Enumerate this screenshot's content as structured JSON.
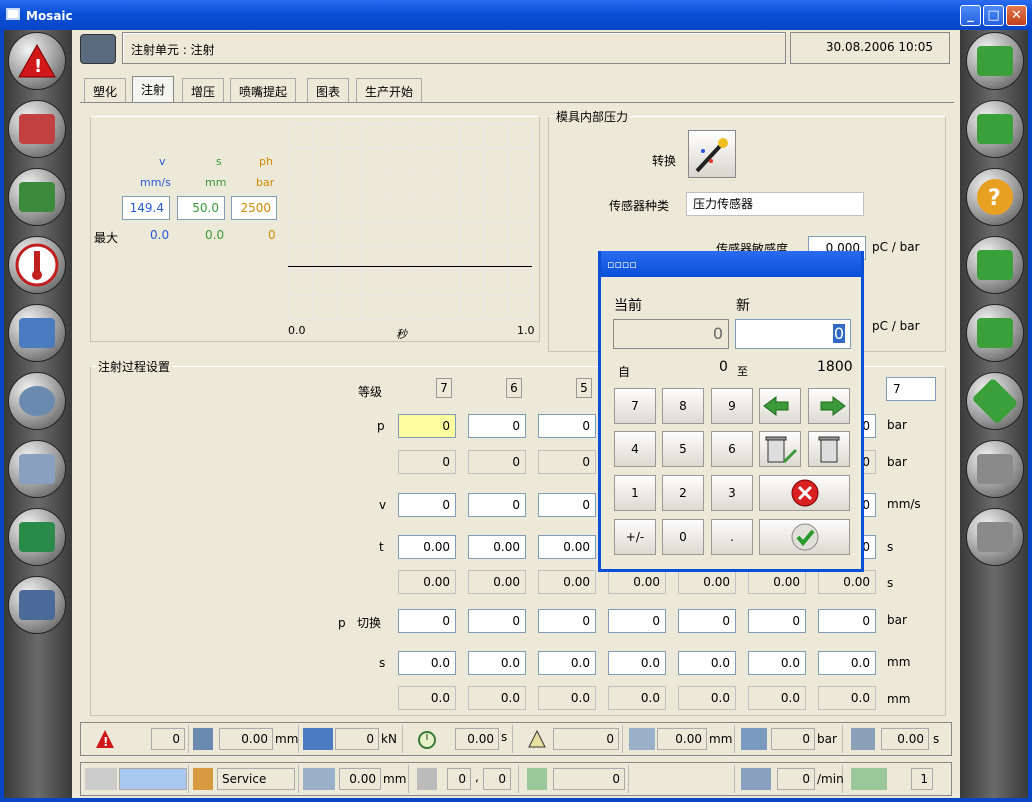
{
  "window": {
    "title": "Mosaic"
  },
  "header": {
    "title": "注射单元 : 注射",
    "datetime": "30.08.2006 10:05"
  },
  "tabs": [
    "塑化",
    "注射",
    "增压",
    "喷嘴提起",
    "图表",
    "生产开始"
  ],
  "active_tab": "注射",
  "speed_panel": {
    "cols": [
      {
        "key": "v",
        "unit": "mm/s",
        "value": "149.4",
        "max": "0.0",
        "color": "#2a5bd7"
      },
      {
        "key": "s",
        "unit": "mm",
        "value": "50.0",
        "max": "0.0",
        "color": "#3a9a3a"
      },
      {
        "key": "ph",
        "unit": "bar",
        "value": "2500",
        "max": "0",
        "color": "#d08a00"
      }
    ],
    "max_label": "最大",
    "chart": {
      "x_start": "0.0",
      "x_end": "1.0",
      "x_unit": "秒"
    }
  },
  "mold_pressure": {
    "title": "模具内部压力",
    "switch_label": "转换",
    "sensor_type_label": "传感器种类",
    "sensor_type_value": "压力传感器",
    "sensitivity_label": "传感器敏感度",
    "sensitivity_value": "0.000",
    "unit1": "pC / bar",
    "unit2": "pC / bar"
  },
  "injection": {
    "title": "注射过程设置",
    "stage_label": "等级",
    "stages": [
      "7",
      "6",
      "5"
    ],
    "stage_last": "7",
    "rows": [
      {
        "label": "p",
        "unit": "bar",
        "values": [
          "0",
          "0",
          "0"
        ],
        "last": "0",
        "editable": true
      },
      {
        "label": "",
        "unit": "bar",
        "values": [
          "0",
          "0",
          "0"
        ],
        "last": "0",
        "editable": false
      },
      {
        "label": "v",
        "unit": "mm/s",
        "values": [
          "0",
          "0",
          "0"
        ],
        "last": "0",
        "editable": true
      },
      {
        "label": "t",
        "unit": "s",
        "values": [
          "0.00",
          "0.00",
          "0.00"
        ],
        "last": "0",
        "editable": true
      },
      {
        "label": "",
        "unit": "s",
        "values": [
          "0.00",
          "0.00",
          "0.00",
          "0.00",
          "0.00",
          "0.00",
          "0.00"
        ],
        "editable": false
      },
      {
        "label": "p   切换",
        "unit": "bar",
        "values": [
          "0",
          "0",
          "0",
          "0",
          "0",
          "0",
          "0"
        ],
        "editable": true
      },
      {
        "label": "s",
        "unit": "mm",
        "values": [
          "0.0",
          "0.0",
          "0.0",
          "0.0",
          "0.0",
          "0.0",
          "0.0"
        ],
        "editable": true
      },
      {
        "label": "",
        "unit": "mm",
        "values": [
          "0.0",
          "0.0",
          "0.0",
          "0.0",
          "0.0",
          "0.0",
          "0.0"
        ],
        "editable": false
      }
    ]
  },
  "dialog": {
    "title": "▫▫▫▫",
    "current_label": "当前",
    "new_label": "新",
    "current_value": "0",
    "new_value": "0",
    "from_label": "自",
    "min": "0",
    "to_label": "至",
    "max": "1800",
    "keys": [
      "7",
      "8",
      "9",
      "4",
      "5",
      "6",
      "1",
      "2",
      "3",
      "+/-",
      "0",
      "."
    ]
  },
  "status1": [
    {
      "icon": "alarm-icon",
      "value": "0",
      "unit": ""
    },
    {
      "icon": "screw-position-icon",
      "value": "0.00",
      "unit": "mm"
    },
    {
      "icon": "clamp-force-icon",
      "value": "0",
      "unit": "kN"
    },
    {
      "icon": "timer-icon",
      "value": "0.00",
      "unit": "s"
    },
    {
      "icon": "warning-icon",
      "value": "0",
      "unit": ""
    },
    {
      "icon": "injection-position-icon",
      "value": "0.00",
      "unit": "mm"
    },
    {
      "icon": "pressure-icon",
      "value": "0",
      "unit": "bar"
    },
    {
      "icon": "cycle-time-icon",
      "value": "0.00",
      "unit": "s"
    }
  ],
  "status2": {
    "user_value": "",
    "service_label": "Service",
    "nozzle_value": "0.00",
    "nozzle_unit": "mm",
    "counter_a": "0",
    "counter_b": "0",
    "count_value": "0",
    "rpm_value": "0",
    "rpm_unit": "/min",
    "mode_value": "1"
  }
}
